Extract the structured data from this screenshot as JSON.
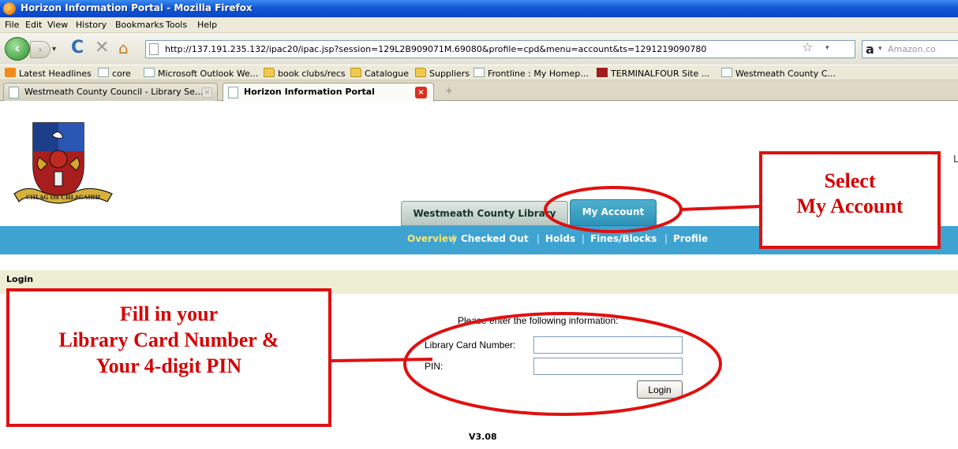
{
  "window": {
    "title": "Horizon Information Portal - Mozilla Firefox"
  },
  "menu": [
    "File",
    "Edit",
    "View",
    "History",
    "Bookmarks",
    "Tools",
    "Help"
  ],
  "navbar": {
    "url": "http://137.191.235.132/ipac20/ipac.jsp?session=129L2B909071M.69080&profile=cpd&menu=account&ts=1291219090780",
    "search_placeholder": "Amazon.co"
  },
  "bookmarks": [
    {
      "label": "Latest Headlines",
      "icon": "rss-icon"
    },
    {
      "label": "core",
      "icon": "page-icon"
    },
    {
      "label": "Microsoft Outlook We...",
      "icon": "page-icon"
    },
    {
      "label": "book clubs/recs",
      "icon": "folder-icon"
    },
    {
      "label": "Catalogue",
      "icon": "folder-icon"
    },
    {
      "label": "Suppliers",
      "icon": "folder-icon"
    },
    {
      "label": "Frontline : My Homep...",
      "icon": "page-icon"
    },
    {
      "label": "TERMINALFOUR Site ...",
      "icon": "terminalfour-icon"
    },
    {
      "label": "Westmeath County C...",
      "icon": "page-icon"
    }
  ],
  "tabs": [
    {
      "label": "Westmeath County Council - Library Se...",
      "active": false
    },
    {
      "label": "Horizon Information Portal",
      "active": true
    }
  ],
  "portal": {
    "crest_motto": "CHLAG OS CHLAGAIBH",
    "tab_library": "Westmeath County Library",
    "tab_account": "My Account",
    "edge_char": "L",
    "subnav": [
      "Overview",
      "Checked Out",
      "Holds",
      "Fines/Blocks",
      "Profile"
    ],
    "login_title": "Login",
    "prompt": "Please enter the following information:",
    "card_label": "Library Card Number:",
    "pin_label": "PIN:",
    "card_value": "",
    "pin_value": "",
    "login_button": "Login",
    "version": "V3.08"
  },
  "annotations": {
    "account_line1": "Select",
    "account_line2": "My Account",
    "login_line1": "Fill in your",
    "login_line2": "Library Card Number &",
    "login_line3": "Your 4-digit PIN",
    "color": "#e01010"
  },
  "colors": {
    "nav_blue": "#3ea3d1",
    "account_tab": "#2d92b7",
    "subnav_active": "#ffe36a",
    "login_bar": "#eeeed4"
  }
}
